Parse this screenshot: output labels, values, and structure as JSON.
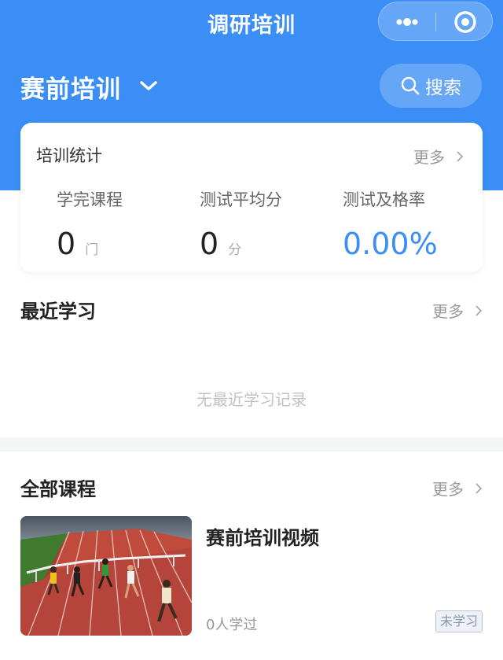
{
  "topbar": {
    "title": "调研培训",
    "more_icon": "more-dots-icon",
    "close_icon": "miniprogram-close-icon"
  },
  "header": {
    "section_label": "赛前培训",
    "dropdown_icon": "chevron-down-icon",
    "search_label": "搜索",
    "search_icon": "search-icon"
  },
  "stats": {
    "title": "培训统计",
    "more_label": "更多",
    "items": [
      {
        "name": "学完课程",
        "value": "0",
        "unit": "门"
      },
      {
        "name": "测试平均分",
        "value": "0",
        "unit": "分"
      },
      {
        "name": "测试及格率",
        "value": "0.00%",
        "unit": ""
      }
    ]
  },
  "recent": {
    "title": "最近学习",
    "more_label": "更多",
    "empty_text": "无最近学习记录"
  },
  "all_courses": {
    "title": "全部课程",
    "more_label": "更多",
    "items": [
      {
        "title": "赛前培训视频",
        "learners": "0人学过",
        "status": "未学习",
        "thumbnail": "hurdle-race-thumbnail"
      }
    ]
  },
  "colors": {
    "accent": "#3a8ef5",
    "muted_text": "#9a9a9a",
    "tag_border": "#b8c4d6"
  }
}
